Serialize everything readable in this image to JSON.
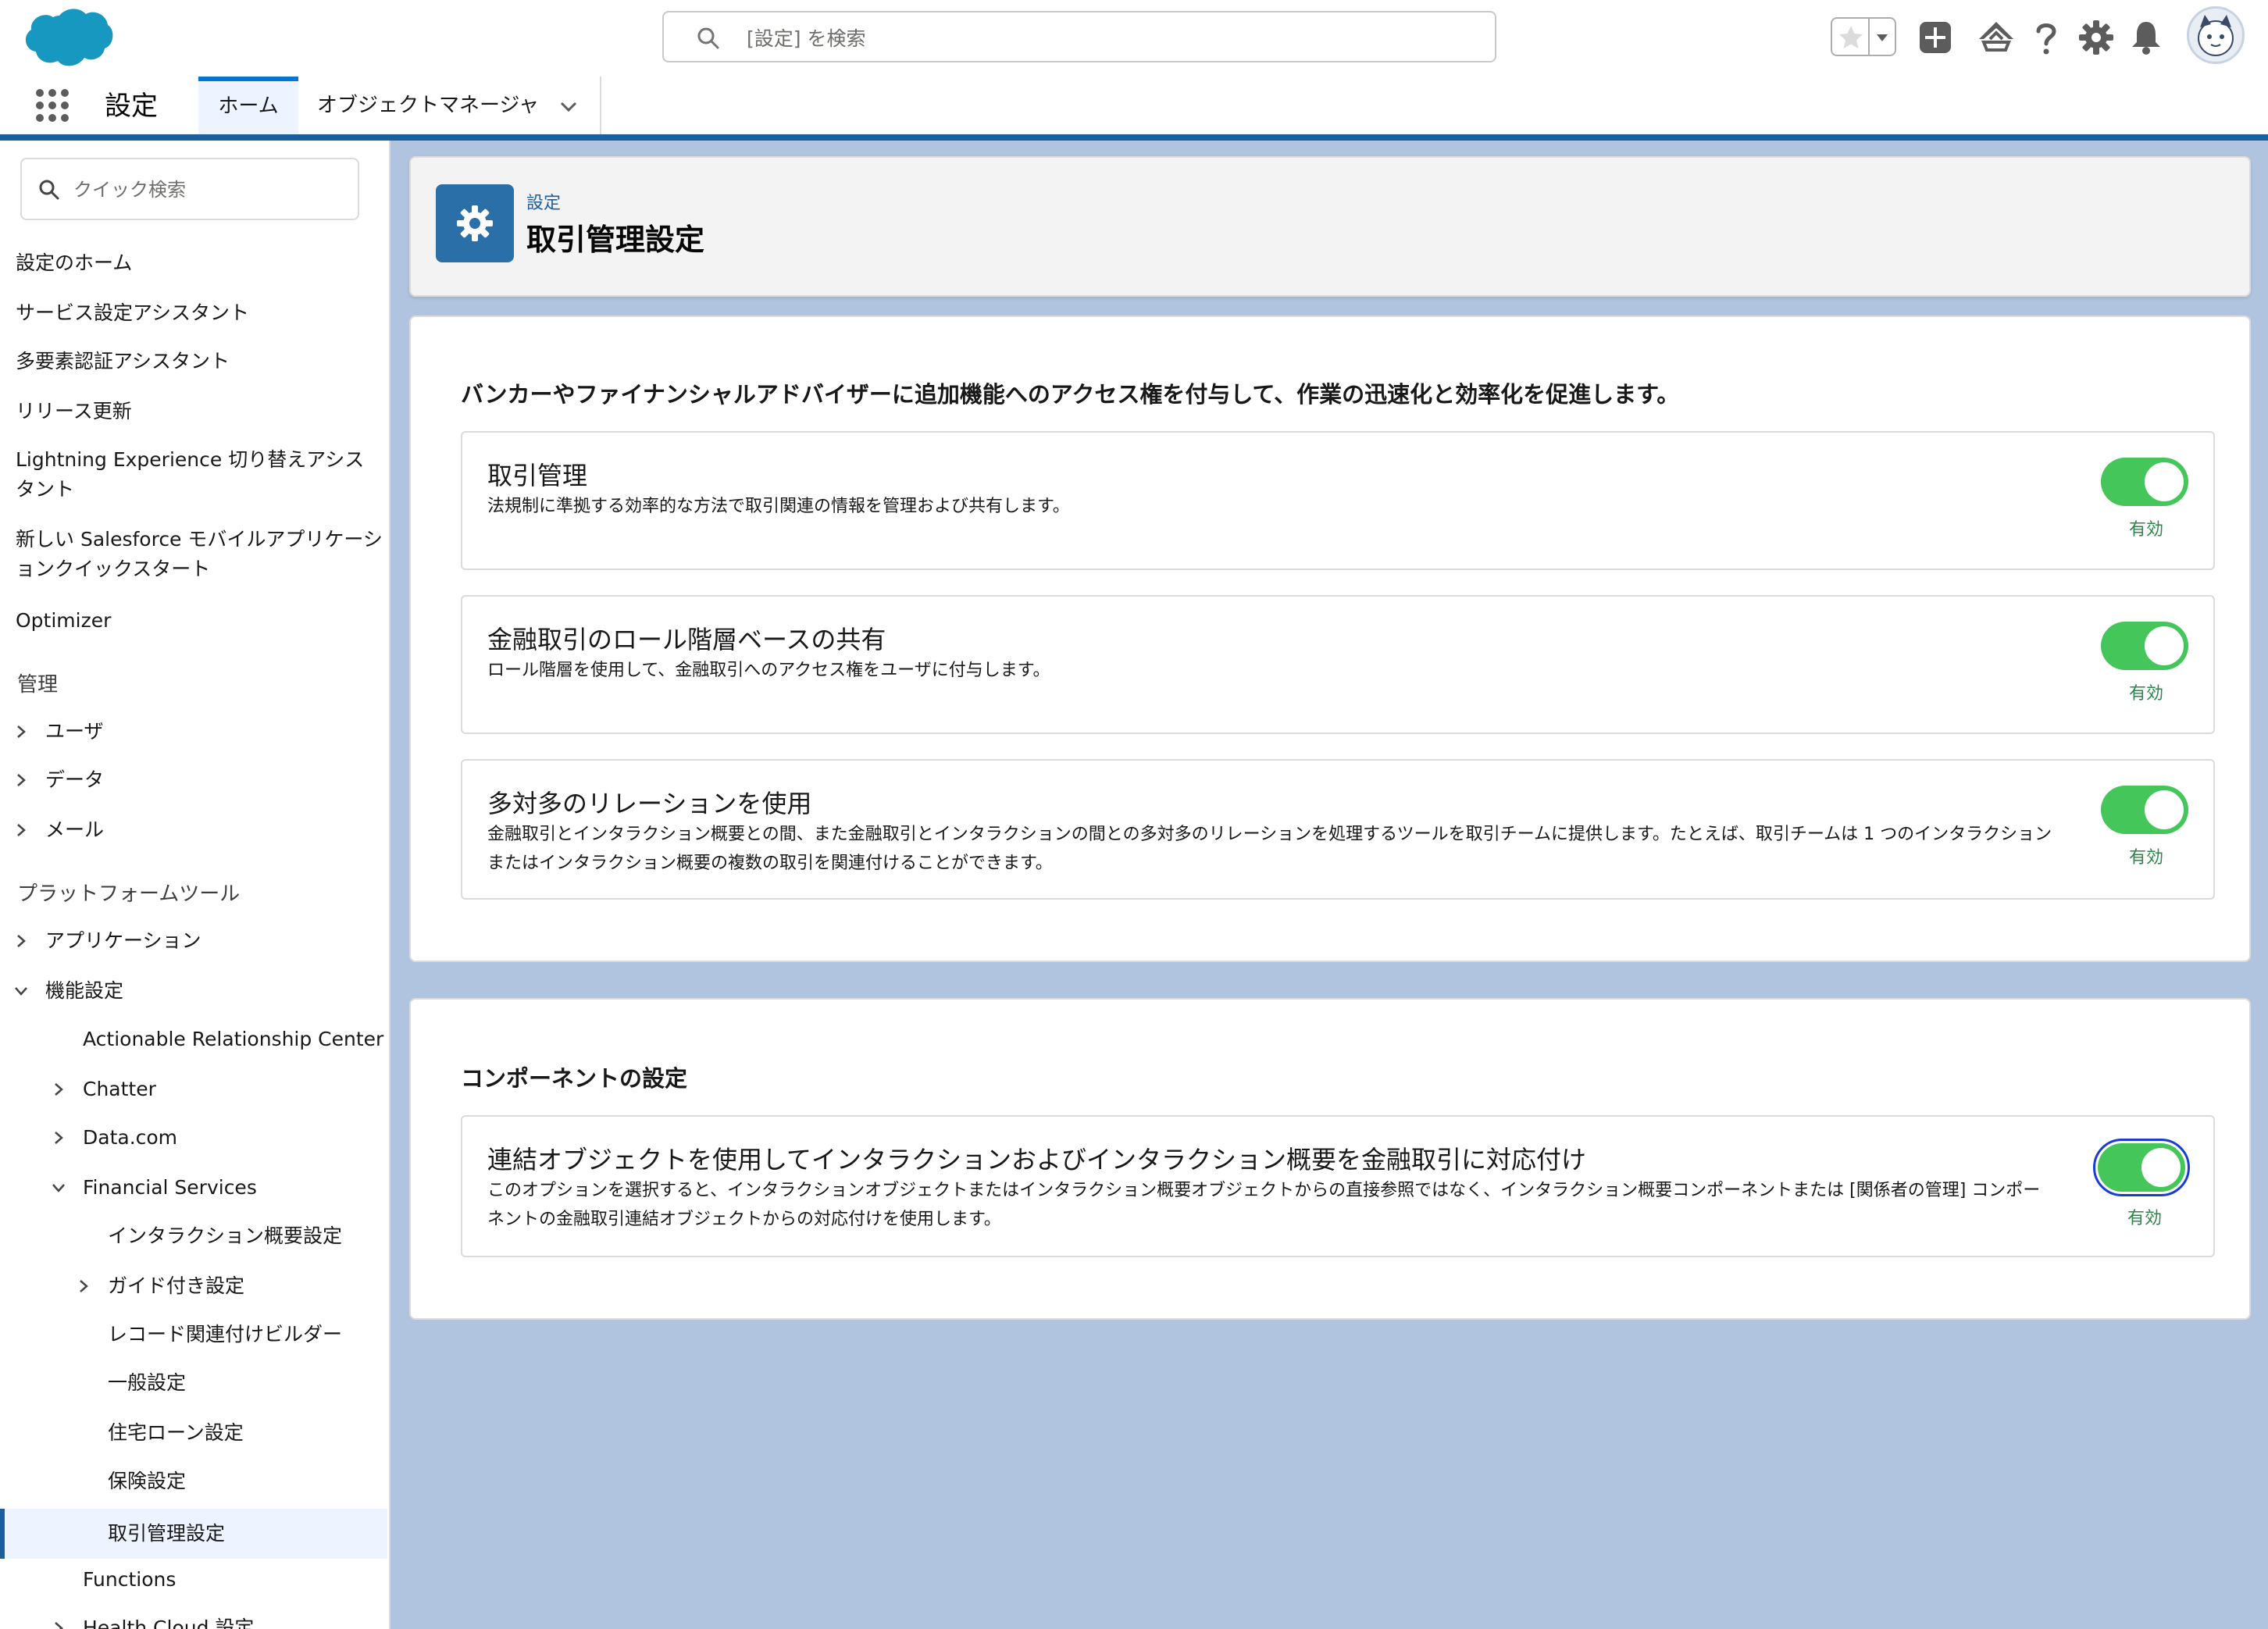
{
  "header": {
    "search_placeholder": "[設定] を検索"
  },
  "context": {
    "app_name": "設定",
    "tabs": [
      {
        "label": "ホーム"
      },
      {
        "label": "オブジェクトマネージャ"
      }
    ]
  },
  "sidebar": {
    "quick_find_placeholder": "クイック検索",
    "items": [
      "設定のホーム",
      "サービス設定アシスタント",
      "多要素認証アシスタント",
      "リリース更新",
      "Lightning Experience 切り替えアシスタント",
      "新しい Salesforce モバイルアプリケーションクイックスタート",
      "Optimizer"
    ],
    "sections": {
      "admin": "管理",
      "platform": "プラットフォームツール"
    },
    "admin_items": [
      "ユーザ",
      "データ",
      "メール"
    ],
    "platform_items": [
      "アプリケーション",
      "機能設定"
    ],
    "feature_items": [
      "Actionable Relationship Center",
      "Chatter",
      "Data.com",
      "Financial Services"
    ],
    "fs_items": [
      "インタラクション概要設定",
      "ガイド付き設定",
      "レコード関連付けビルダー",
      "一般設定",
      "住宅ローン設定",
      "保険設定",
      "取引管理設定"
    ],
    "after_items": [
      "Functions"
    ],
    "partial_item": "Health Cloud 設定"
  },
  "page": {
    "breadcrumb": "設定",
    "title": "取引管理設定"
  },
  "card1": {
    "intro": "バンカーやファイナンシャルアドバイザーに追加機能へのアクセス権を付与して、作業の迅速化と効率化を促進します。",
    "settings": [
      {
        "title": "取引管理",
        "description": "法規制に準拠する効率的な方法で取引関連の情報を管理および共有します。",
        "status": "有効"
      },
      {
        "title": "金融取引のロール階層ベースの共有",
        "description": "ロール階層を使用して、金融取引へのアクセス権をユーザに付与します。",
        "status": "有効"
      },
      {
        "title": "多対多のリレーションを使用",
        "description": "金融取引とインタラクション概要との間、また金融取引とインタラクションの間との多対多のリレーションを処理するツールを取引チームに提供します。たとえば、取引チームは 1 つのインタラクションまたはインタラクション概要の複数の取引を関連付けることができます。",
        "status": "有効"
      }
    ]
  },
  "card2": {
    "heading": "コンポーネントの設定",
    "settings": [
      {
        "title": "連結オブジェクトを使用してインタラクションおよびインタラクション概要を金融取引に対応付け",
        "description": "このオプションを選択すると、インタラクションオブジェクトまたはインタラクション概要オブジェクトからの直接参照ではなく、インタラクション概要コンポーネントまたは [関係者の管理] コンポーネントの金融取引連結オブジェクトからの対応付けを使用します。",
        "status": "有効"
      }
    ]
  },
  "colors": {
    "brand_blue": "#1b5f9e",
    "toggle_on": "#45c65a",
    "status_text": "#2e844a",
    "background": "#b0c4df"
  }
}
